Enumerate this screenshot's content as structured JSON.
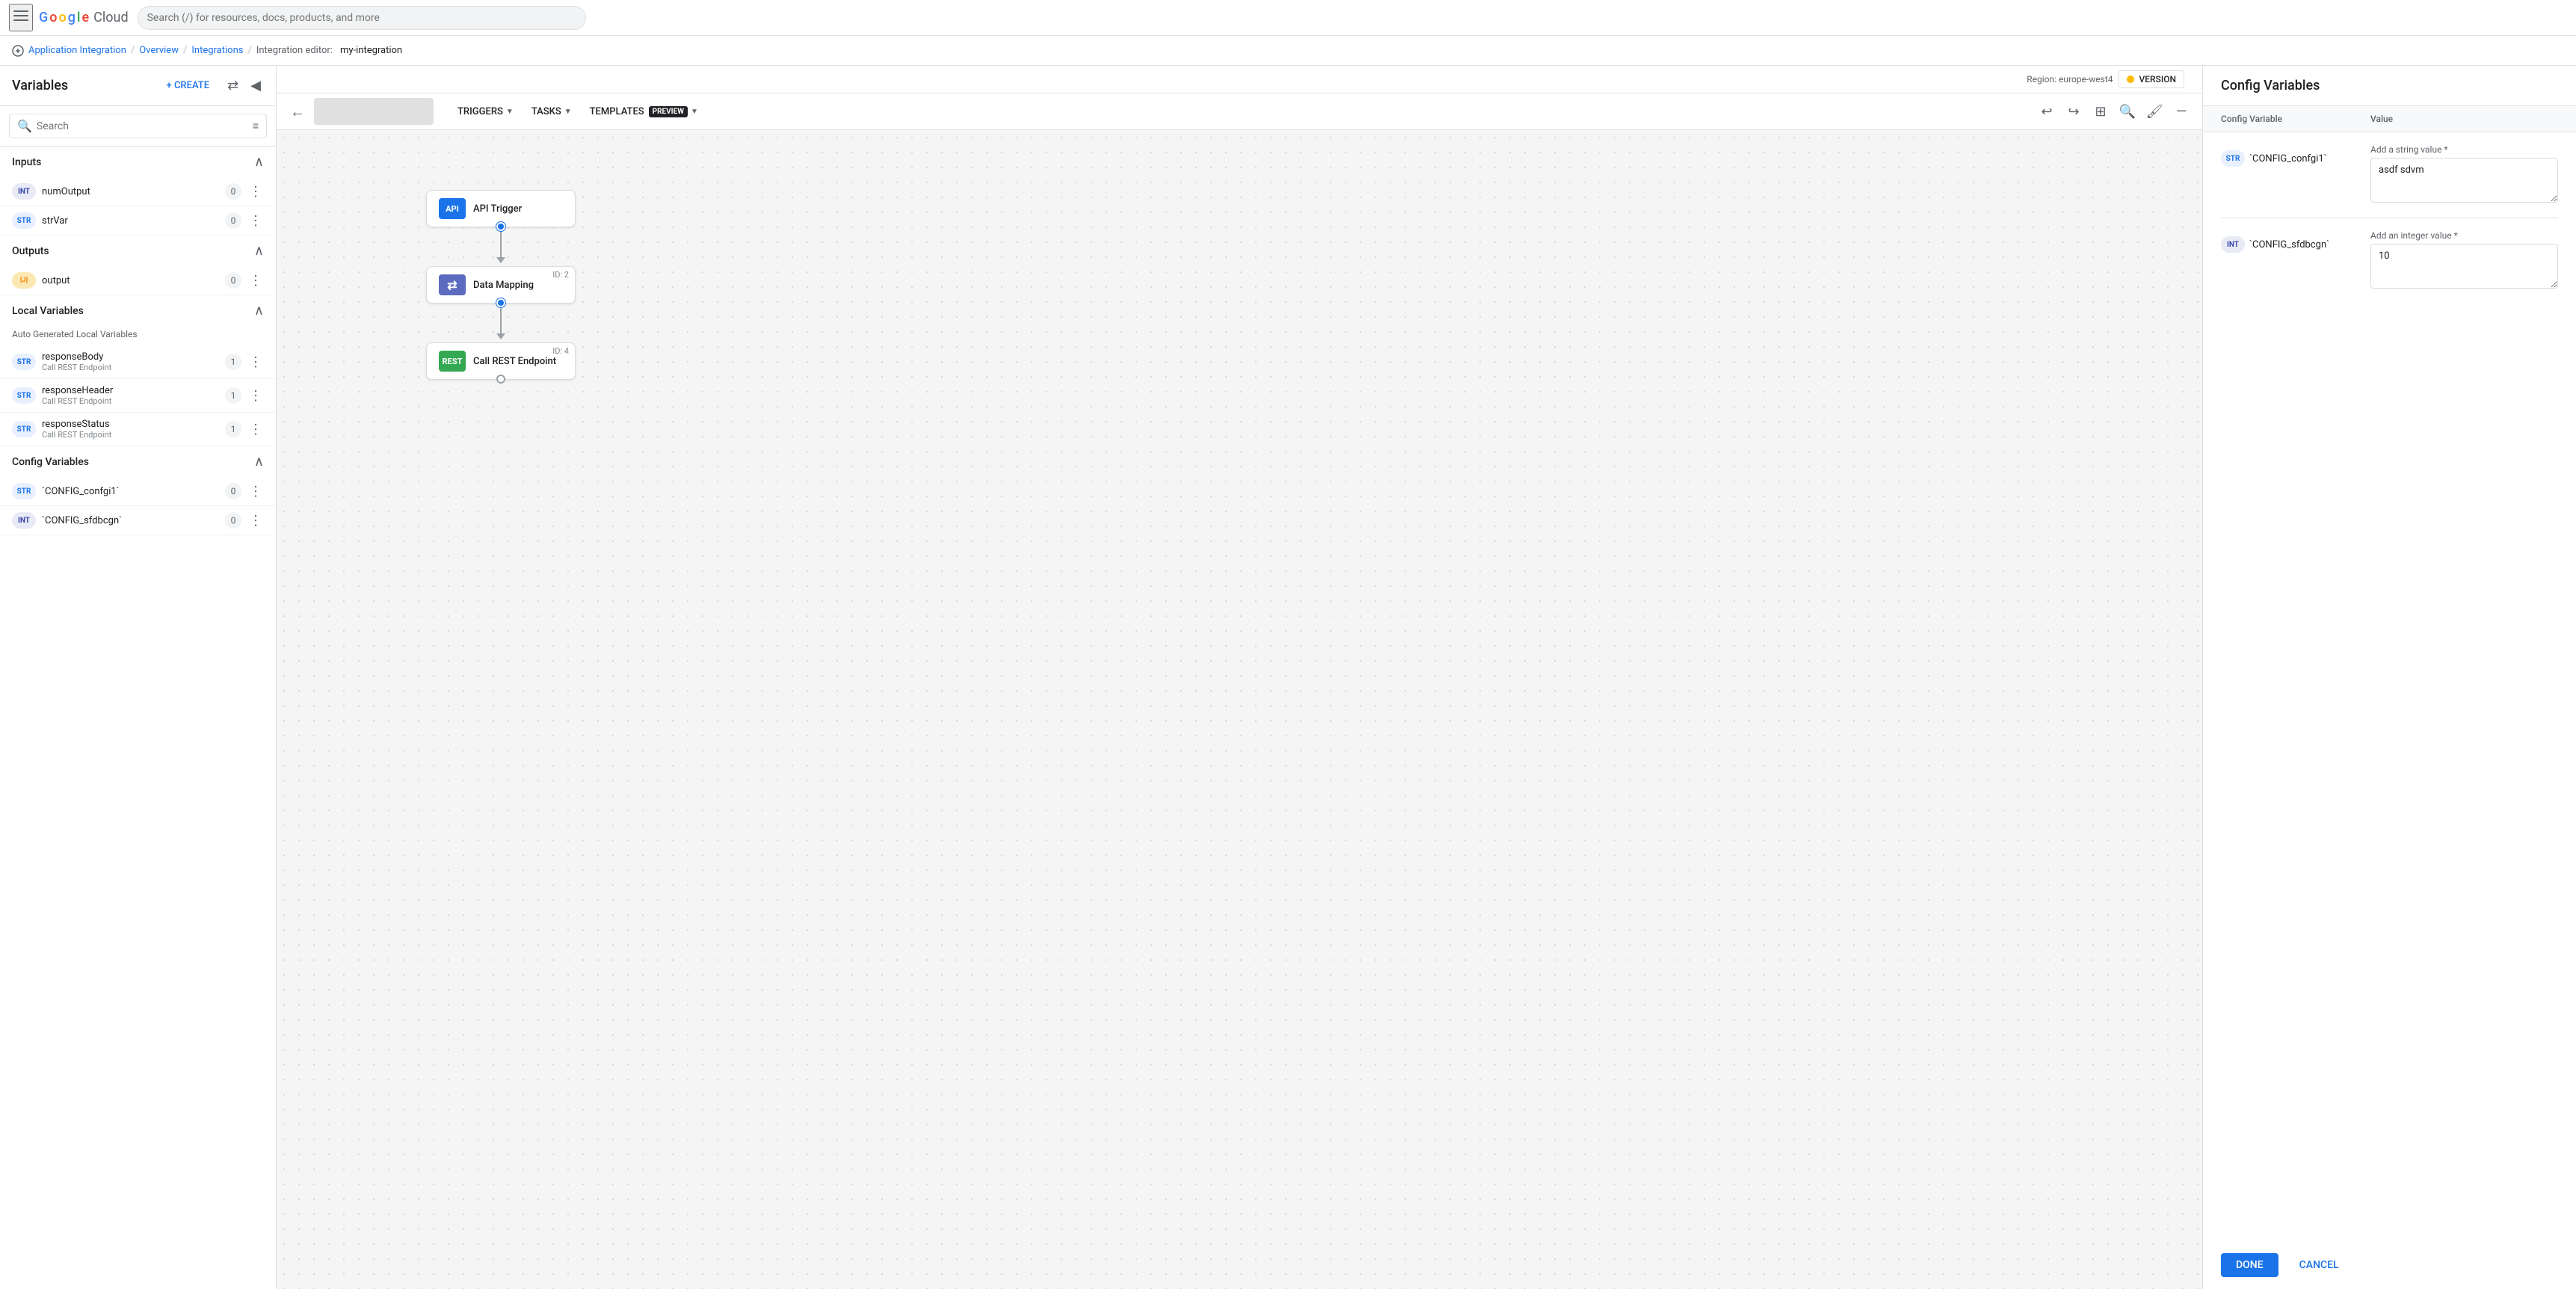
{
  "topbar": {
    "menu_icon": "☰",
    "logo_google": "Google",
    "logo_cloud": "Cloud",
    "search_placeholder": "Search (/) for resources, docs, products, and more"
  },
  "breadcrumb": {
    "app_integration": "Application Integration",
    "overview": "Overview",
    "integrations": "Integrations",
    "integration_editor": "Integration editor:"
  },
  "back_button": "←",
  "region": {
    "label": "Region: europe-west4"
  },
  "version_badge": {
    "label": "VERSION"
  },
  "sidebar": {
    "title": "Variables",
    "create_label": "+ CREATE",
    "search_placeholder": "Search",
    "sections": {
      "inputs": {
        "title": "Inputs",
        "items": [
          {
            "type": "INT",
            "type_class": "int",
            "name": "numOutput",
            "count": "0"
          },
          {
            "type": "STR",
            "type_class": "str",
            "name": "strVar",
            "count": "0"
          }
        ]
      },
      "outputs": {
        "title": "Outputs",
        "items": [
          {
            "type": "JSON",
            "type_class": "json",
            "name": "output",
            "count": "0"
          }
        ]
      },
      "local_variables": {
        "title": "Local Variables",
        "auto_generated_label": "Auto Generated Local Variables",
        "items": [
          {
            "type": "STR",
            "type_class": "str",
            "name": "responseBody",
            "sub": "Call REST Endpoint",
            "count": "1"
          },
          {
            "type": "STR",
            "type_class": "str",
            "name": "responseHeader",
            "sub": "Call REST Endpoint",
            "count": "1"
          },
          {
            "type": "STR",
            "type_class": "str",
            "name": "responseStatus",
            "sub": "Call REST Endpoint",
            "count": "1"
          }
        ]
      },
      "config_variables": {
        "title": "Config Variables",
        "items": [
          {
            "type": "STR",
            "type_class": "str",
            "name": "`CONFIG_confgi1`",
            "count": "0"
          },
          {
            "type": "INT",
            "type_class": "int",
            "name": "`CONFIG_sfdbcgn`",
            "count": "0"
          }
        ]
      }
    }
  },
  "canvas_toolbar": {
    "triggers_label": "TRIGGERS",
    "tasks_label": "TASKS",
    "templates_label": "TEMPLATES",
    "preview_label": "PREVIEW"
  },
  "flow": {
    "nodes": [
      {
        "id": "",
        "icon": "API",
        "icon_class": "api",
        "label": "API Trigger"
      },
      {
        "id": "ID: 2",
        "icon": "⇄",
        "icon_class": "dm",
        "label": "Data Mapping"
      },
      {
        "id": "ID: 4",
        "icon": "REST",
        "icon_class": "rest",
        "label": "Call REST Endpoint"
      }
    ]
  },
  "right_panel": {
    "title": "Config Variables",
    "col1_label": "Config Variable",
    "col2_label": "Value",
    "rows": [
      {
        "type": "STR",
        "type_class": "str",
        "var_name": "`CONFIG_confgi1`",
        "value_label": "Add a string value *",
        "value": "asdf sdvm"
      },
      {
        "type": "INT",
        "type_class": "int",
        "var_name": "`CONFIG_sfdbcgn`",
        "value_label": "Add an integer value *",
        "value": "10"
      }
    ],
    "done_label": "DONE",
    "cancel_label": "CANCEL"
  }
}
